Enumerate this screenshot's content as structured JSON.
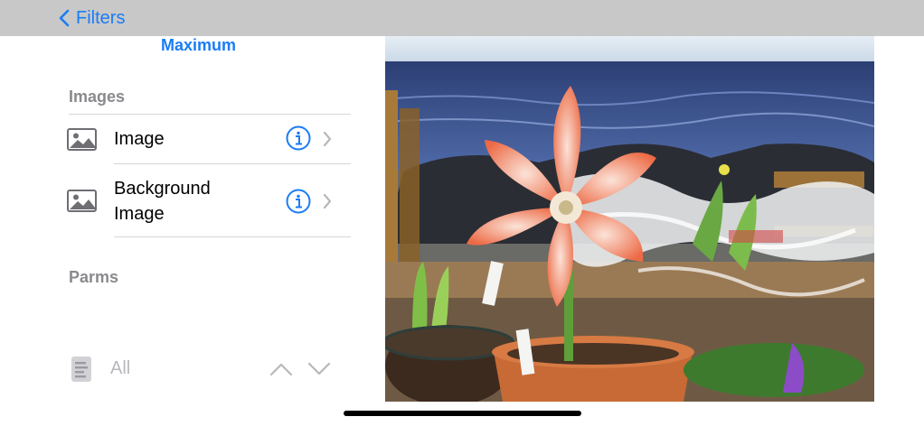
{
  "navbar": {
    "back_label": "Filters",
    "back_icon": "chevron-left-icon"
  },
  "filter": {
    "mode_label": "Maximum"
  },
  "images_section": {
    "header": "Images",
    "rows": [
      {
        "label": "Image",
        "icon": "photo-icon",
        "info_icon": "info-icon",
        "chevron_icon": "chevron-right-icon"
      },
      {
        "label_line1": "Background",
        "label_line2": "Image",
        "icon": "photo-icon",
        "info_icon": "info-icon",
        "chevron_icon": "chevron-right-icon"
      }
    ]
  },
  "parms_section": {
    "header": "Parms"
  },
  "bottom_bar": {
    "all_label": "All",
    "doc_icon": "document-icon",
    "up_icon": "chevron-up-icon",
    "down_icon": "chevron-down-icon"
  },
  "preview": {
    "description_icon": "image-preview",
    "colors": {
      "sea": "#3d5c9a",
      "sky": "#d8e4ef",
      "flower": "#ef7a5a",
      "frame": "#a87a3a"
    }
  },
  "colors": {
    "accent": "#1a7cf5",
    "navbar_bg": "#c8c8c8",
    "secondary_text": "#8a8a8e",
    "disabled": "#b8b8bc"
  }
}
